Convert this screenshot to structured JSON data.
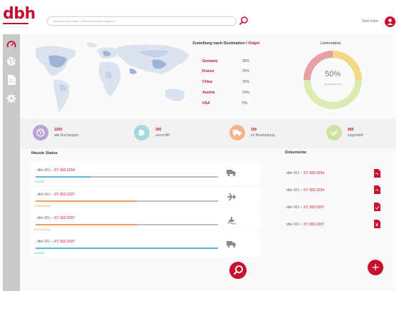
{
  "brand": {
    "logo": "dbh",
    "accent": "#c8102e"
  },
  "search": {
    "placeholder": "Buchung oder Ware / Referenznummer eingeben"
  },
  "user": {
    "name": "Test User"
  },
  "sidebar": {
    "items": [
      "speedometer-icon",
      "globe-icon",
      "document-icon",
      "gear-icon"
    ]
  },
  "destinations": {
    "title": "Zustellung nach Destination /",
    "title_highlight": "Origin",
    "rows": [
      {
        "country": "Germany",
        "pct": "35%"
      },
      {
        "country": "France",
        "pct": "25%"
      },
      {
        "country": "China",
        "pct": "15%"
      },
      {
        "country": "Austria",
        "pct": "10%"
      },
      {
        "country": "USA",
        "pct": "5%"
      }
    ]
  },
  "lieferstatus": {
    "title": "Lieferstatus",
    "value": "50%",
    "sub": "letzter Steve Lock",
    "segments": [
      {
        "color": "#f3d886",
        "fraction": 0.25
      },
      {
        "color": "#dcebb1",
        "fraction": 0.5
      },
      {
        "color": "#e9a0a4",
        "fraction": 0.25
      }
    ]
  },
  "stats": [
    {
      "num": "1200",
      "label": "alle Buchungen",
      "color": "#b8a3d6",
      "icon": "globe-icon"
    },
    {
      "num": "300",
      "label": "verschifft",
      "color": "#a7d8e1",
      "icon": "arrow-icon"
    },
    {
      "num": "100",
      "label": "im Bearbeitung",
      "color": "#f6b48c",
      "icon": "truck-icon"
    },
    {
      "num": "800",
      "label": "zugestellt",
      "color": "#cfe2a1",
      "icon": "check-icon"
    }
  ],
  "status": {
    "title": "Neuste Status",
    "cards": [
      {
        "id": "dbh-001 – ",
        "ref": "XY 300-2254",
        "status": "verschifft",
        "status_color": "#5bb6d9",
        "progress": 0.3,
        "icon": "truck-icon"
      },
      {
        "id": "dbh-001 – ",
        "ref": "XY 302-2207",
        "status": "In Bearbeitung",
        "status_color": "#f29b5c",
        "progress": 0.55,
        "icon": "plane-icon"
      },
      {
        "id": "dbh-001 – ",
        "ref": "XY 302-2207",
        "status": "In Bearbeitung",
        "status_color": "#f29b5c",
        "progress": 0.55,
        "icon": "ship-icon"
      },
      {
        "id": "dbh-001 – ",
        "ref": "XY 302-2207",
        "status": "verschifft",
        "status_color": "#5bb6d9",
        "progress": 1.0,
        "icon": "truck-icon"
      }
    ]
  },
  "documents": {
    "title": "Dokumente",
    "items": [
      {
        "id": "dbh-001 – ",
        "ref": "XY 300-2254"
      },
      {
        "id": "dbh-001 – ",
        "ref": "XY 302-2204"
      },
      {
        "id": "dbh-001 – ",
        "ref": "XY 302-2207"
      },
      {
        "id": "dbh-001 – ",
        "ref": "XY 302-2207"
      }
    ]
  }
}
